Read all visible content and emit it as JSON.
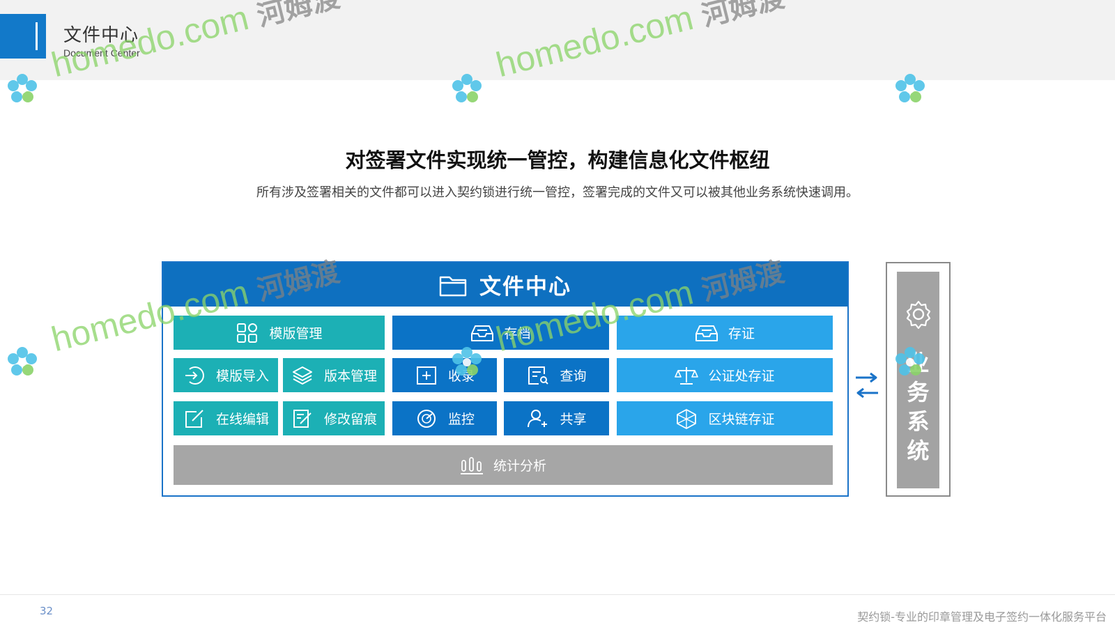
{
  "header": {
    "title_cn": "文件中心",
    "title_en": "Document Center"
  },
  "headline": "对签署文件实现统一管控，构建信息化文件枢纽",
  "subline": "所有涉及签署相关的文件都可以进入契约锁进行统一管控，签署完成的文件又可以被其他业务系统快速调用。",
  "panel": {
    "title": "文件中心",
    "tiles": {
      "template_mgmt": "模版管理",
      "archive": "存档",
      "evidence": "存证",
      "template_import": "模版导入",
      "version_mgmt": "版本管理",
      "collect": "收录",
      "query": "查询",
      "notary_evidence": "公证处存证",
      "online_edit": "在线编辑",
      "revision_trace": "修改留痕",
      "monitor": "监控",
      "share": "共享",
      "blockchain_evidence": "区块链存证",
      "statistics": "统计分析"
    }
  },
  "side": {
    "chars": [
      "业",
      "务",
      "系",
      "统"
    ]
  },
  "footer": {
    "page_number": "32",
    "text": "契约锁-专业的印章管理及电子签约一体化服务平台"
  },
  "watermark": {
    "brand": "homedo.com",
    "cn": "河姆渡"
  },
  "colors": {
    "accent": "#1279c9",
    "teal": "#1cb0b5",
    "dark_blue": "#0b73c6",
    "light_blue": "#2aa5ea",
    "gray": "#a6a6a6"
  }
}
